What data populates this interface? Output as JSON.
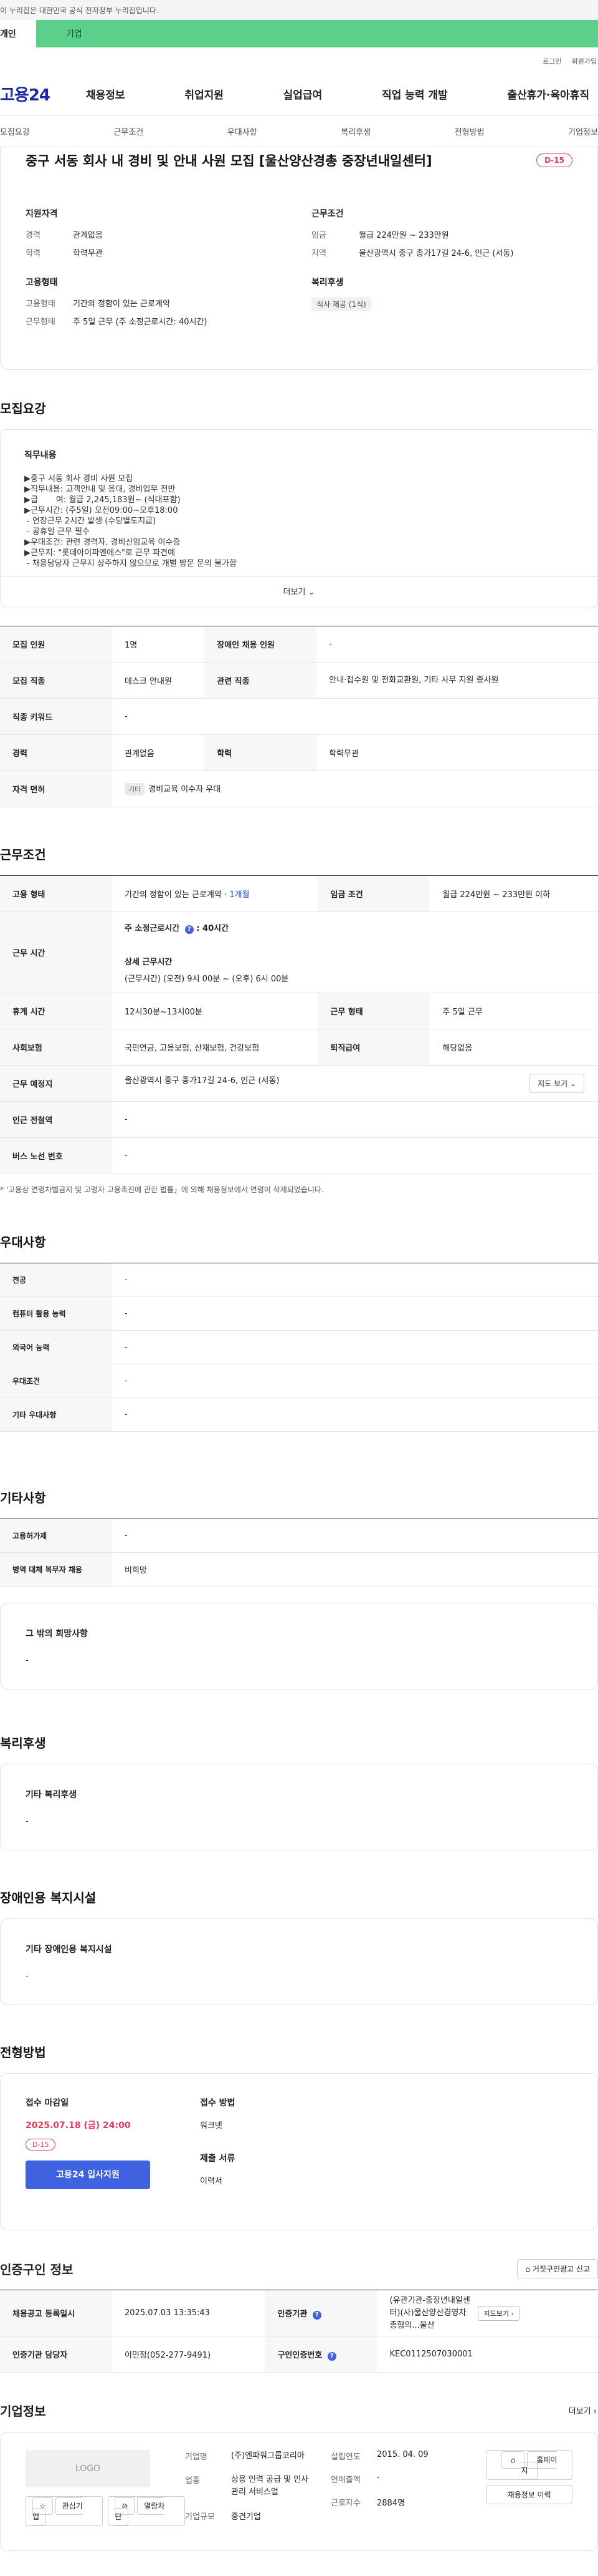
{
  "banner": {
    "text": "이 누리집은 대한민국 공식 전자정부 누리집입니다."
  },
  "user_tabs": {
    "personal": "개인",
    "company": "기업"
  },
  "util": {
    "login": "로그인",
    "join": "회원가입"
  },
  "logo": "고용24",
  "gnb": [
    "채용정보",
    "취업지원",
    "실업급여",
    "직업 능력 개발",
    "출산휴가·육아휴직"
  ],
  "anchors": [
    "모집요강",
    "근무조건",
    "우대사항",
    "복리후생",
    "전형방법",
    "기업정보"
  ],
  "summary": {
    "title": "중구 서동 회사 내 경비 및 안내 사원 모집 [울산양산경총 중장년내일센터]",
    "dday": "D-15",
    "qualification_title": "지원자격",
    "career_label": "경력",
    "career": "관계없음",
    "education_label": "학력",
    "education": "학력무관",
    "employment_title": "고용형태",
    "emp_type_label": "고용형태",
    "emp_type": "기간의 정함이 있는 근로계약",
    "work_type_label": "근무형태",
    "work_type": "주 5일 근무 (주 소정근로시간: 40시간)",
    "conditions_title": "근무조건",
    "wage_label": "임금",
    "wage": "월급 224만원 ~ 233만원",
    "region_label": "지역",
    "region": "울산광역시 중구 종가17길 24-6, 인근 (서동)",
    "welfare_title": "복리후생",
    "welfare_tag": "식사 제공 (1식)"
  },
  "recruit": {
    "section_title": "모집요강",
    "detail_title": "직무내용",
    "detail_text": "▶중구 서동 회사 경비 사원 모집\n▶직무내용: 고객안내 및 응대, 경비업무 전반\n▶급       여: 월급 2,245,183원~ (식대포함)\n▶근무시간: (주5일) 오전09:00~오후18:00\n - 연장근무 2시간 발생 (수당별도지급)\n - 공휴일 근무 필수\n▶우대조건: 관련 경력자, 경비신임교육 이수증\n▶근무지: \"롯데아이파엔에스\"로 근무 파견예\n - 채용담당자 근무지 상주하지 않으므로 개별 방문 문의 불가함",
    "more": "더보기",
    "rows": {
      "headcount_k": "모집 인원",
      "headcount": "1명",
      "disabled_k": "장애인 채용 인원",
      "disabled": "-",
      "job_k": "모집 직종",
      "job": "데스크 안내원",
      "related_k": "관련 직종",
      "related": "안내·접수원 및 전화교환원, 기타 사무 지원 종사원",
      "keyword_k": "직종 키워드",
      "keyword": "-",
      "career_k": "경력",
      "career": "관계없음",
      "edu_k": "학력",
      "edu": "학력무관",
      "license_k": "자격 면허",
      "license_tag": "기타",
      "license": "경비교육 이수자 우대"
    }
  },
  "work": {
    "section_title": "근무조건",
    "emp_k": "고용 형태",
    "emp": "기간의 정함이 있는 근로계약 · ",
    "emp_link": "1개월",
    "wage_k": "임금 조건",
    "wage": "월급 224만원 ~ 233만원 이하",
    "hours_k": "근무 시간",
    "hours_line1": "주 소정근로시간",
    "hours_value": ": 40시간",
    "hours_detail_title": "상세 근무시간",
    "hours_detail": "(근무시간) (오전) 9시 00분 ~ (오후) 6시 00분",
    "break_k": "휴게 시간",
    "break": "12시30분~13시00분",
    "worktype_k": "근무 형태",
    "worktype": "주 5일 근무",
    "insurance_k": "사회보험",
    "insurance": "국민연금, 고용보험, 산재보험, 건강보험",
    "retire_k": "퇴직급여",
    "retire": "해당없음",
    "location_k": "근무 예정지",
    "location": "울산광역시 중구 종가17길 24-6, 인근 (서동)",
    "map_btn": "지도 보기",
    "subway_k": "인근 전철역",
    "subway": "-",
    "bus_k": "버스 노선 번호",
    "bus": "-",
    "footnote": "* '고용상 연령차별금지 및 고령자 고용촉진에 관한 법률」에 의해 채용정보에서 연령이 삭제되었습니다."
  },
  "pref": {
    "section_title": "우대사항",
    "rows": [
      {
        "k": "전공",
        "v": "-"
      },
      {
        "k": "컴퓨터 활용 능력",
        "v": "-"
      },
      {
        "k": "외국어 능력",
        "v": "-"
      },
      {
        "k": "우대조건",
        "v": "-"
      },
      {
        "k": "기타 우대사항",
        "v": "-"
      }
    ]
  },
  "etc": {
    "section_title": "기타사항",
    "rows": [
      {
        "k": "고용허가제",
        "v": "-"
      },
      {
        "k": "병역 대체 복무자 채용",
        "v": "비희망"
      }
    ],
    "hope_title": "그 밖의 희망사항",
    "hope": "-"
  },
  "welfare": {
    "section_title": "복리후생",
    "box_title": "기타 복리후생",
    "value": "-"
  },
  "disabled_fac": {
    "section_title": "장애인용 복지시설",
    "box_title": "기타 장애인용 복지시설",
    "value": "-"
  },
  "selection": {
    "section_title": "전형방법",
    "deadline_title": "접수 마감일",
    "deadline": "2025.07.18 (금) 24:00",
    "dday": "D-15",
    "apply_btn": "고용24 입사지원",
    "method_title": "접수 방법",
    "method": "워크넷",
    "docs_title": "제출 서류",
    "docs": "이력서"
  },
  "cert": {
    "section_title": "인증구인 정보",
    "report_btn": "거짓구인광고 신고",
    "reg_k": "채용공고 등록일시",
    "reg": "2025.07.03 13:35:43",
    "org_k": "인증기관",
    "org": "(유관기관-중장년내일센터)(사)울산양산경영자총협의...울산",
    "org_btn": "지도보기",
    "manager_k": "인증기관 담당자",
    "manager": "이민정(052-277-9491)",
    "cert_no_k": "구인인증번호",
    "cert_no": "KEC0112507030001"
  },
  "company": {
    "section_title": "기업정보",
    "more": "더보기",
    "logo_ph": "LOGO",
    "interest_btn": "관심기업",
    "block_btn": "열람차단",
    "name_k": "기업명",
    "name": "(주)엔파워그룹코리아",
    "industry_k": "업종",
    "industry": "상용 인력 공급 및 인사관리 서비스업",
    "scale_k": "기업규모",
    "scale": "중견기업",
    "founded_k": "설립연도",
    "founded": "2015. 04. 09",
    "sales_k": "연매출액",
    "sales": "-",
    "employees_k": "근로자수",
    "employees": "2884명",
    "homepage_btn": "홈페이지",
    "history_btn": "채용정보 이력"
  }
}
